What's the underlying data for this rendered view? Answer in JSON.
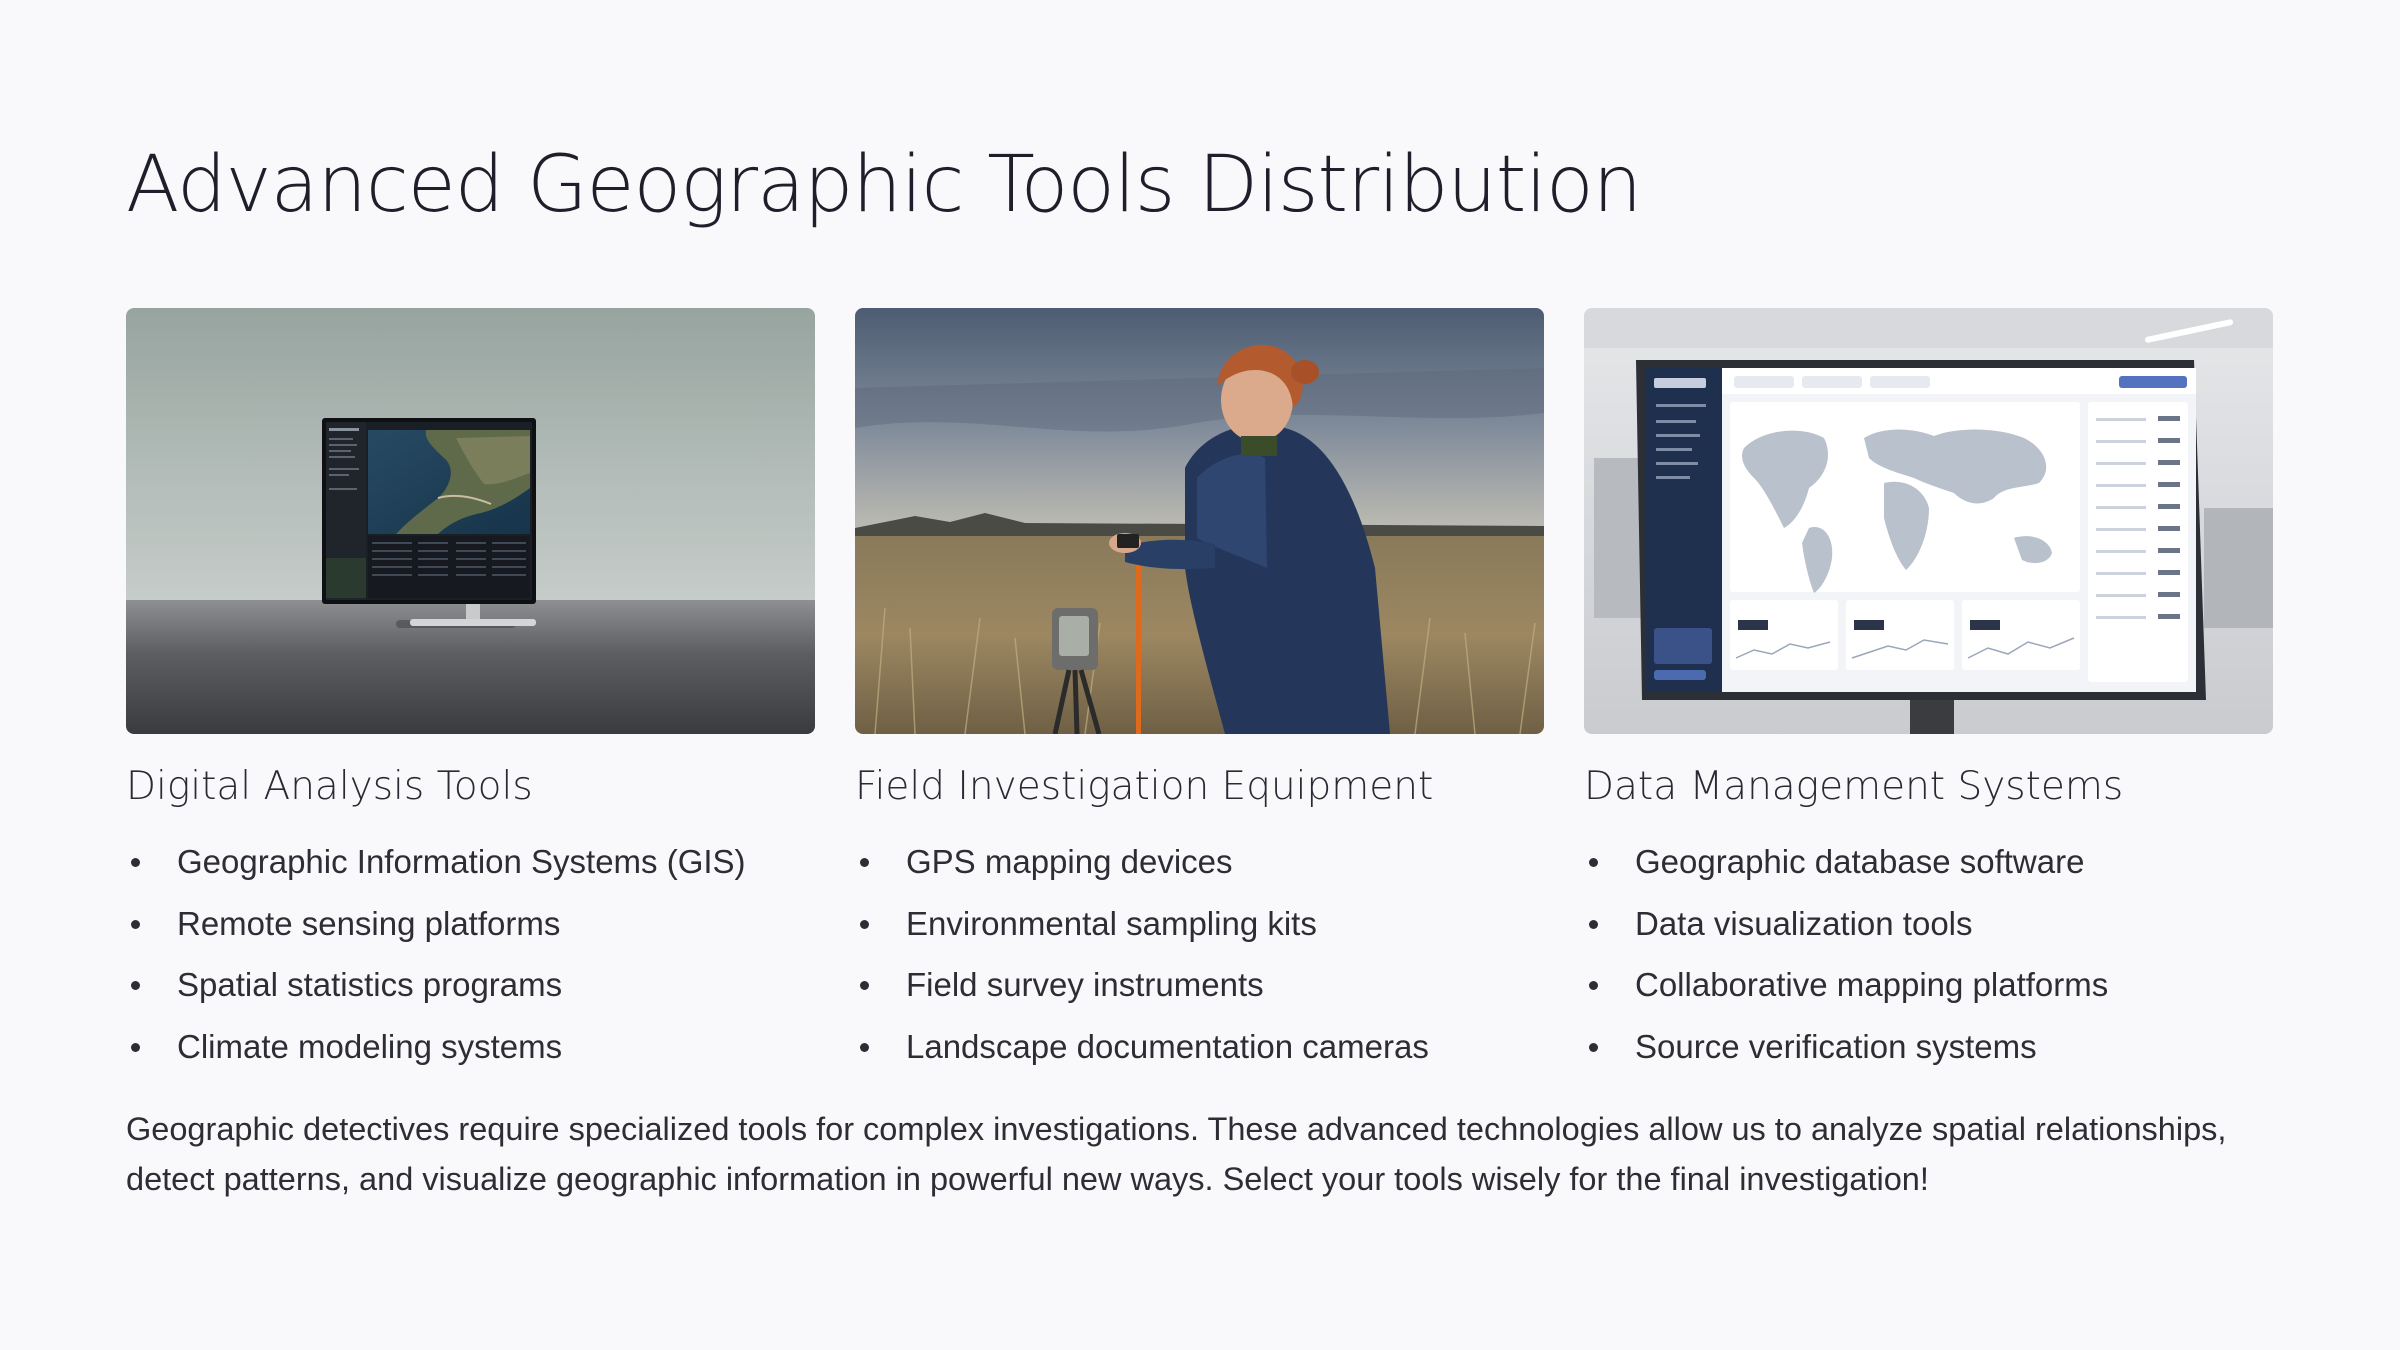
{
  "title": "Advanced Geographic Tools Distribution",
  "columns": [
    {
      "heading": "Digital Analysis Tools",
      "image_icon": "monitor-with-map-image",
      "items": [
        "Geographic Information Systems (GIS)",
        "Remote sensing platforms",
        "Spatial statistics programs",
        "Climate modeling systems"
      ]
    },
    {
      "heading": "Field Investigation Equipment",
      "image_icon": "field-researcher-image",
      "items": [
        "GPS mapping devices",
        "Environmental sampling kits",
        "Field survey instruments",
        "Landscape documentation cameras"
      ]
    },
    {
      "heading": "Data Management Systems",
      "image_icon": "dashboard-monitor-image",
      "items": [
        "Geographic database software",
        "Data visualization tools",
        "Collaborative mapping platforms",
        "Source verification systems"
      ]
    }
  ],
  "paragraph": "Geographic detectives require specialized tools for complex investigations. These advanced technologies allow us to analyze spatial relationships, detect patterns, and visualize geographic information in powerful new ways. Select your tools wisely for the final investigation!",
  "colors": {
    "background": "#f9f9fb",
    "title": "#1e1f2b",
    "text": "#2d2d35"
  }
}
